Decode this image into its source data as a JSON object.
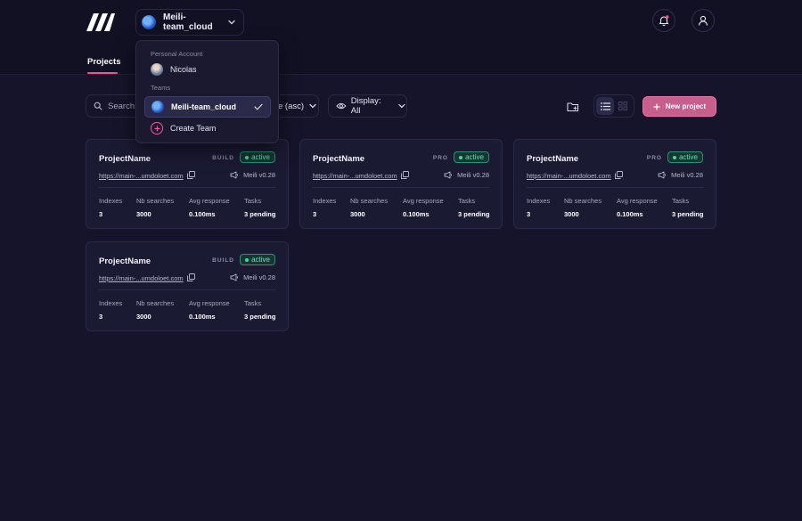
{
  "header": {
    "logo_icon": "meilisearch-logo-icon",
    "team_selector": {
      "label": "Meili-team_cloud",
      "avatar_icon": "team-avatar-icon"
    },
    "notifications_icon": "bell-icon",
    "account_icon": "user-icon"
  },
  "tabs": [
    {
      "label": "Projects",
      "active": true
    }
  ],
  "toolbar": {
    "search_placeholder": "Search",
    "sort_label": "e (asc)",
    "display_label": "Display: All",
    "new_project_label": "New project"
  },
  "dropdown": {
    "personal_heading": "Personal Account",
    "personal_user": "Nicolas",
    "teams_heading": "Teams",
    "selected_team": "Meili-team_cloud",
    "create_team_label": "Create Team"
  },
  "stat_labels": {
    "indexes": "Indexes",
    "searches": "Nb searches",
    "response": "Avg response",
    "tasks": "Tasks"
  },
  "projects": [
    {
      "name": "ProjectName",
      "plan": "BUILD",
      "status": "active",
      "url": "https://main-...umdoloet.com",
      "version": "Meili v0.28",
      "indexes": "3",
      "searches": "3000",
      "response": "0.100ms",
      "tasks": "3 pending"
    },
    {
      "name": "ProjectName",
      "plan": "PRO",
      "status": "active",
      "url": "https://main-...umdoloet.com",
      "version": "Meili v0.28",
      "indexes": "3",
      "searches": "3000",
      "response": "0.100ms",
      "tasks": "3 pending"
    },
    {
      "name": "ProjectName",
      "plan": "PRO",
      "status": "active",
      "url": "https://main-...umdoloet.com",
      "version": "Meili v0.28",
      "indexes": "3",
      "searches": "3000",
      "response": "0.100ms",
      "tasks": "3 pending"
    },
    {
      "name": "ProjectName",
      "plan": "BUILD",
      "status": "active",
      "url": "https://main-...umdoloet.com",
      "version": "Meili v0.28",
      "indexes": "3",
      "searches": "3000",
      "response": "0.100ms",
      "tasks": "3 pending"
    }
  ],
  "colors": {
    "background": "#15142a",
    "accent": "#c75e8c",
    "tab_underline": "#ff4f9a",
    "status_active": "#5fe2c2"
  }
}
